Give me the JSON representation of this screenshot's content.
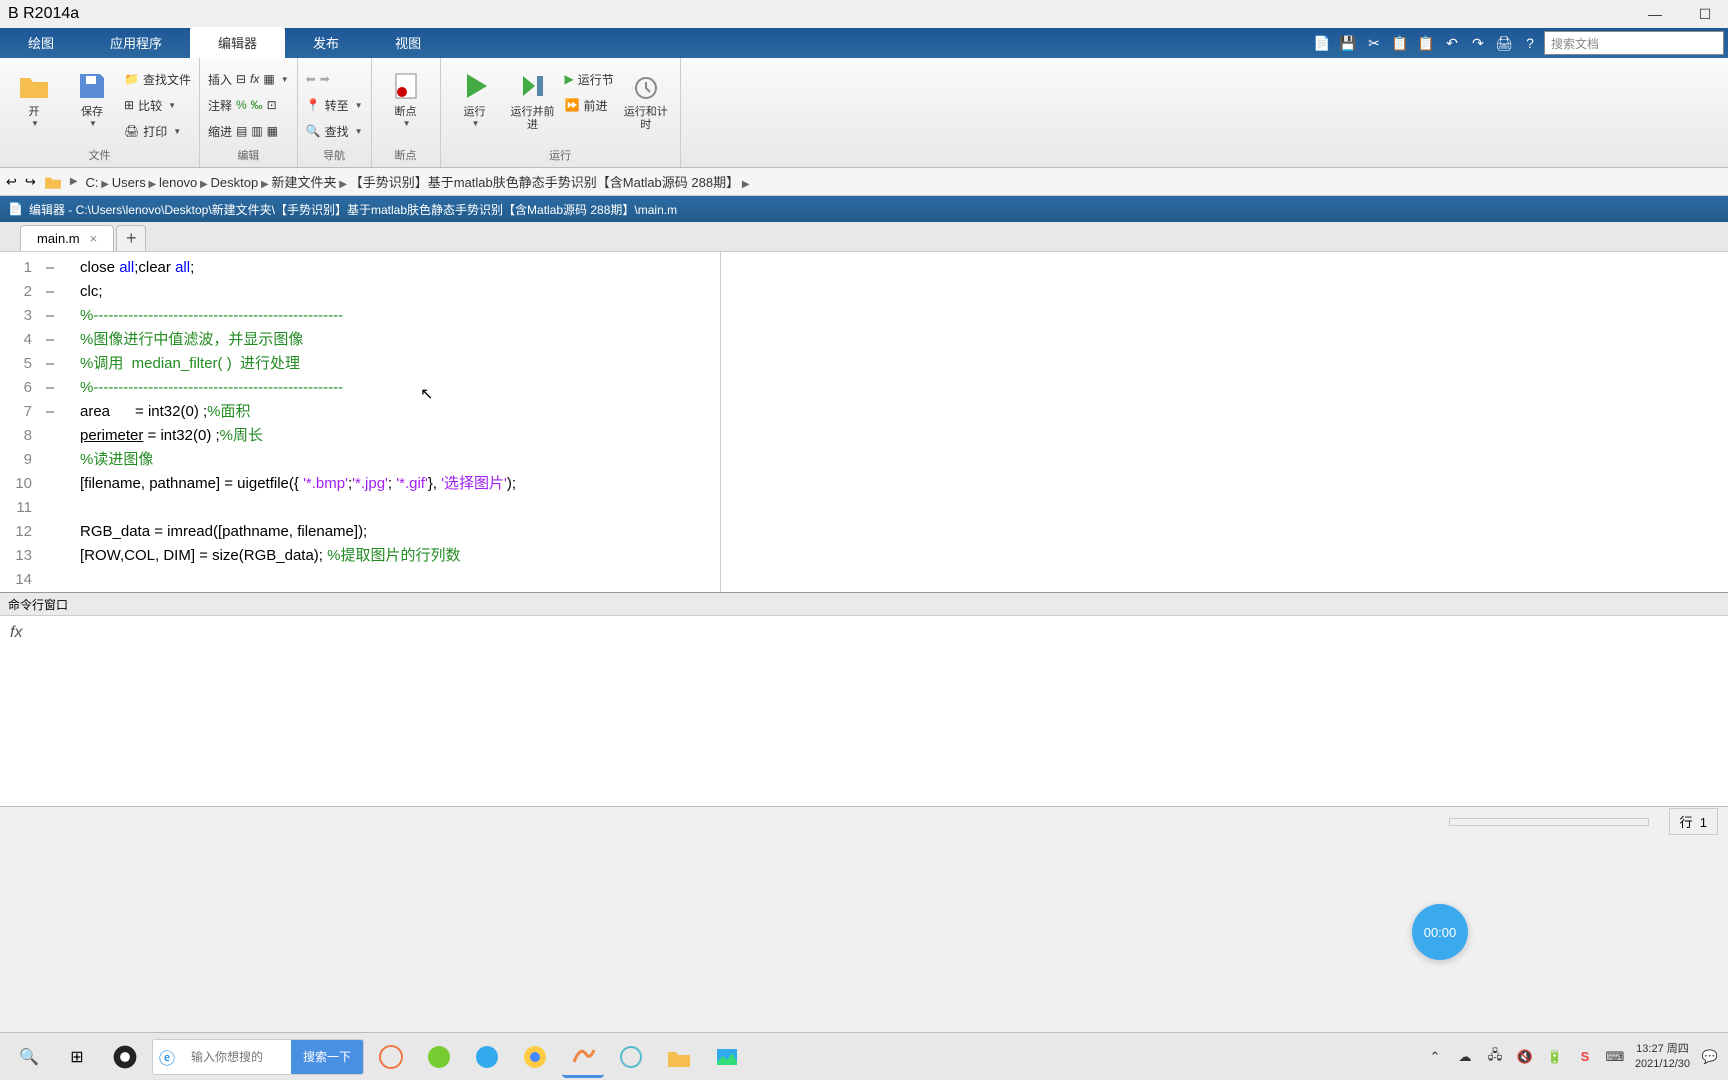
{
  "titlebar": {
    "title": "B R2014a"
  },
  "ribbon": {
    "tabs": [
      "绘图",
      "应用程序",
      "编辑器",
      "发布",
      "视图"
    ],
    "active_index": 2,
    "search_placeholder": "搜索文档",
    "groups": {
      "file": {
        "label": "文件",
        "open": "开",
        "save": "保存",
        "find_files": "查找文件",
        "compare": "比较",
        "print": "打印"
      },
      "edit": {
        "label": "编辑",
        "insert": "插入",
        "comment": "注释",
        "indent": "缩进"
      },
      "nav": {
        "label": "导航",
        "goto": "转至",
        "find": "查找"
      },
      "breakpoint": {
        "label": "断点",
        "btn": "断点"
      },
      "run": {
        "label": "运行",
        "run": "运行",
        "run_advance": "运行并前进",
        "run_section": "运行节",
        "advance": "前进",
        "run_time": "运行和计时"
      }
    }
  },
  "path": {
    "crumbs": [
      "C:",
      "Users",
      "lenovo",
      "Desktop",
      "新建文件夹",
      "【手势识别】基于matlab肤色静态手势识别【含Matlab源码 288期】"
    ]
  },
  "editor": {
    "title_prefix": "编辑器 - ",
    "title_path": "C:\\Users\\lenovo\\Desktop\\新建文件夹\\【手势识别】基于matlab肤色静态手势识别【含Matlab源码 288期】\\main.m",
    "tab_name": "main.m"
  },
  "code": {
    "lines": [
      {
        "n": 1,
        "exec": "–",
        "html": "close <span class='kw-blue'>all</span>;clear <span class='kw-blue'>all</span>;"
      },
      {
        "n": 2,
        "exec": "–",
        "html": "clc;"
      },
      {
        "n": 3,
        "exec": "",
        "html": "<span class='kw-green'>%--------------------------------------------------</span>"
      },
      {
        "n": 4,
        "exec": "",
        "html": "<span class='kw-green'>%图像进行中值滤波，并显示图像</span>"
      },
      {
        "n": 5,
        "exec": "",
        "html": "<span class='kw-green'>%调用  median_filter( )  进行处理</span>"
      },
      {
        "n": 6,
        "exec": "",
        "html": "<span class='kw-green'>%--------------------------------------------------</span>"
      },
      {
        "n": 7,
        "exec": "–",
        "html": "area      = int32(0) ;<span class='kw-green'>%面积</span>"
      },
      {
        "n": 8,
        "exec": "–",
        "html": "<span class='underline'>perimeter</span> = int32(0) ;<span class='kw-green'>%周长</span>"
      },
      {
        "n": 9,
        "exec": "",
        "html": "<span class='kw-green'>%读进图像</span>"
      },
      {
        "n": 10,
        "exec": "–",
        "html": "[filename, pathname] = uigetfile({ <span class='kw-purple'>'*.bmp'</span>;<span class='kw-purple'>'*.jpg'</span>; <span class='kw-purple'>'*.gif'</span>}, <span class='kw-purple'>'选择图片'</span>);"
      },
      {
        "n": 11,
        "exec": "",
        "html": ""
      },
      {
        "n": 12,
        "exec": "–",
        "html": "RGB_data = imread([pathname, filename]);"
      },
      {
        "n": 13,
        "exec": "–",
        "html": "[ROW,COL, DIM] = size(RGB_data); <span class='kw-green'>%提取图片的行列数</span>"
      },
      {
        "n": 14,
        "exec": "",
        "html": ""
      }
    ]
  },
  "cmd": {
    "title": "命令行窗口",
    "prompt": "fx"
  },
  "timer": "00:00",
  "status": {
    "line_label": "行",
    "line_num": "1"
  },
  "taskbar": {
    "search_placeholder": "输入你想搜的",
    "search_btn": "搜索一下",
    "time": "13:27",
    "day": "周四",
    "date": "2021/12/30"
  }
}
